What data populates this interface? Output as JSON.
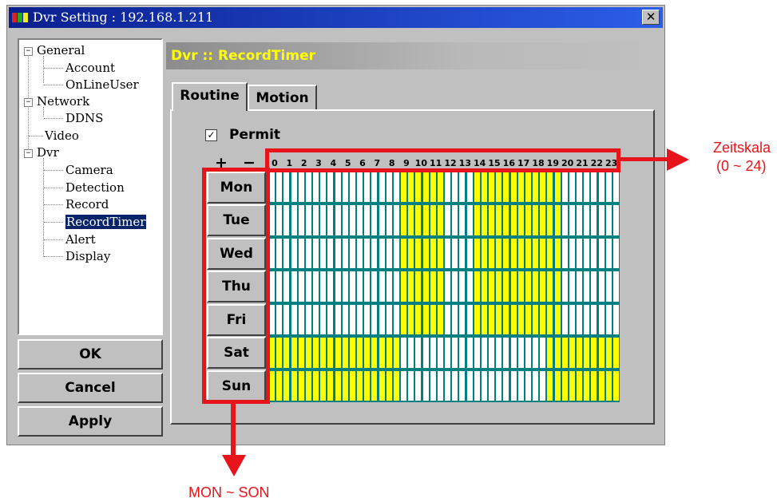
{
  "window": {
    "title": "Dvr Setting : 192.168.1.211",
    "close_label": "✕"
  },
  "tree": {
    "items": [
      {
        "label": "General",
        "expander": "−"
      },
      {
        "label": "Account"
      },
      {
        "label": "OnLineUser"
      },
      {
        "label": "Network",
        "expander": "−"
      },
      {
        "label": "DDNS"
      },
      {
        "label": "Video"
      },
      {
        "label": "Dvr",
        "expander": "−"
      },
      {
        "label": "Camera"
      },
      {
        "label": "Detection"
      },
      {
        "label": "Record"
      },
      {
        "label": "RecordTimer",
        "selected": true
      },
      {
        "label": "Alert"
      },
      {
        "label": "Display"
      }
    ]
  },
  "buttons": {
    "ok": "OK",
    "cancel": "Cancel",
    "apply": "Apply"
  },
  "header": {
    "title": "Dvr :: RecordTimer"
  },
  "tabs": [
    {
      "label": "Routine",
      "active": true
    },
    {
      "label": "Motion"
    }
  ],
  "permit": {
    "label": "Permit",
    "checked": true,
    "check_glyph": "✓"
  },
  "scale_controls": {
    "plus": "+",
    "minus": "−"
  },
  "hours": [
    "0",
    "1",
    "2",
    "3",
    "4",
    "5",
    "6",
    "7",
    "8",
    "9",
    "10",
    "11",
    "12",
    "13",
    "14",
    "15",
    "16",
    "17",
    "18",
    "19",
    "20",
    "21",
    "22",
    "23"
  ],
  "days": [
    "Mon",
    "Tue",
    "Wed",
    "Thu",
    "Fri",
    "Sat",
    "Sun"
  ],
  "schedule": {
    "weekday_hours": [
      9,
      10,
      11,
      14,
      15,
      16,
      17,
      18,
      19
    ],
    "weekend_hours": [
      0,
      1,
      2,
      3,
      4,
      5,
      6,
      7,
      8,
      19,
      20,
      21,
      22,
      23
    ],
    "colors": {
      "on": "#ffff00",
      "off": "#ffffff",
      "grid": "#008080"
    }
  },
  "annotations": {
    "timescale": {
      "line1": "Zeitskala",
      "line2": "(0 ~ 24)"
    },
    "days": "MON ~ SON",
    "color": "#e8141c"
  }
}
